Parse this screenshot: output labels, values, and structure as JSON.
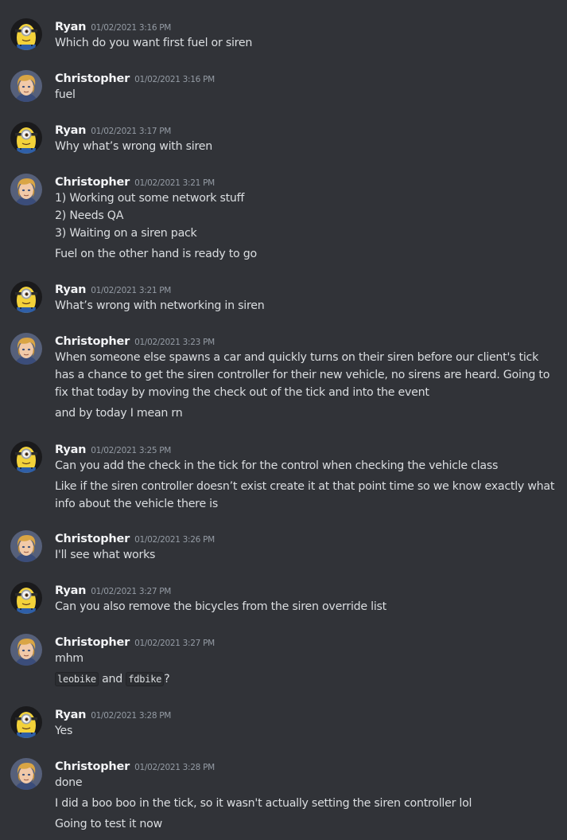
{
  "messages": [
    {
      "author": "Ryan",
      "time": "01/02/2021 3:16 PM",
      "lines": [
        "Which do you want first fuel or siren"
      ]
    },
    {
      "author": "Christopher",
      "time": "01/02/2021 3:16 PM",
      "lines": [
        "fuel"
      ]
    },
    {
      "author": "Ryan",
      "time": "01/02/2021 3:17 PM",
      "lines": [
        "Why what’s wrong with siren"
      ]
    },
    {
      "author": "Christopher",
      "time": "01/02/2021 3:21 PM",
      "lines": [
        "1) Working out some network stuff",
        "2) Needs QA",
        "3) Waiting on a siren pack",
        "Fuel on the other hand is ready to go"
      ]
    },
    {
      "author": "Ryan",
      "time": "01/02/2021 3:21 PM",
      "lines": [
        "What’s wrong with networking in siren"
      ]
    },
    {
      "author": "Christopher",
      "time": "01/02/2021 3:23 PM",
      "lines": [
        "When someone else spawns a car and quickly turns on their siren before our client's tick has a chance to get the siren controller for their new vehicle, no sirens are heard. Going to fix that today by moving the check out of the tick and into the event",
        "and by today I mean rn"
      ]
    },
    {
      "author": "Ryan",
      "time": "01/02/2021 3:25 PM",
      "lines": [
        "Can you add the check in the tick for the control when checking the vehicle class",
        "Like if the siren controller doesn’t exist create it at that point time so we know exactly what info about the vehicle there is"
      ]
    },
    {
      "author": "Christopher",
      "time": "01/02/2021 3:26 PM",
      "lines": [
        "I'll see what works"
      ]
    },
    {
      "author": "Ryan",
      "time": "01/02/2021 3:27 PM",
      "lines": [
        "Can you also remove the bicycles from the siren override list"
      ]
    },
    {
      "author": "Christopher",
      "time": "01/02/2021 3:27 PM",
      "lines": [
        "mhm"
      ],
      "code_line": {
        "code1": "leobike",
        "mid": "and",
        "code2": "fdbike",
        "end": "?"
      }
    },
    {
      "author": "Ryan",
      "time": "01/02/2021 3:28 PM",
      "lines": [
        "Yes"
      ]
    },
    {
      "author": "Christopher",
      "time": "01/02/2021 3:28 PM",
      "lines": [
        "done",
        "I did a boo boo in the tick, so it wasn't actually setting the siren controller lol",
        "Going to test it now"
      ]
    }
  ]
}
